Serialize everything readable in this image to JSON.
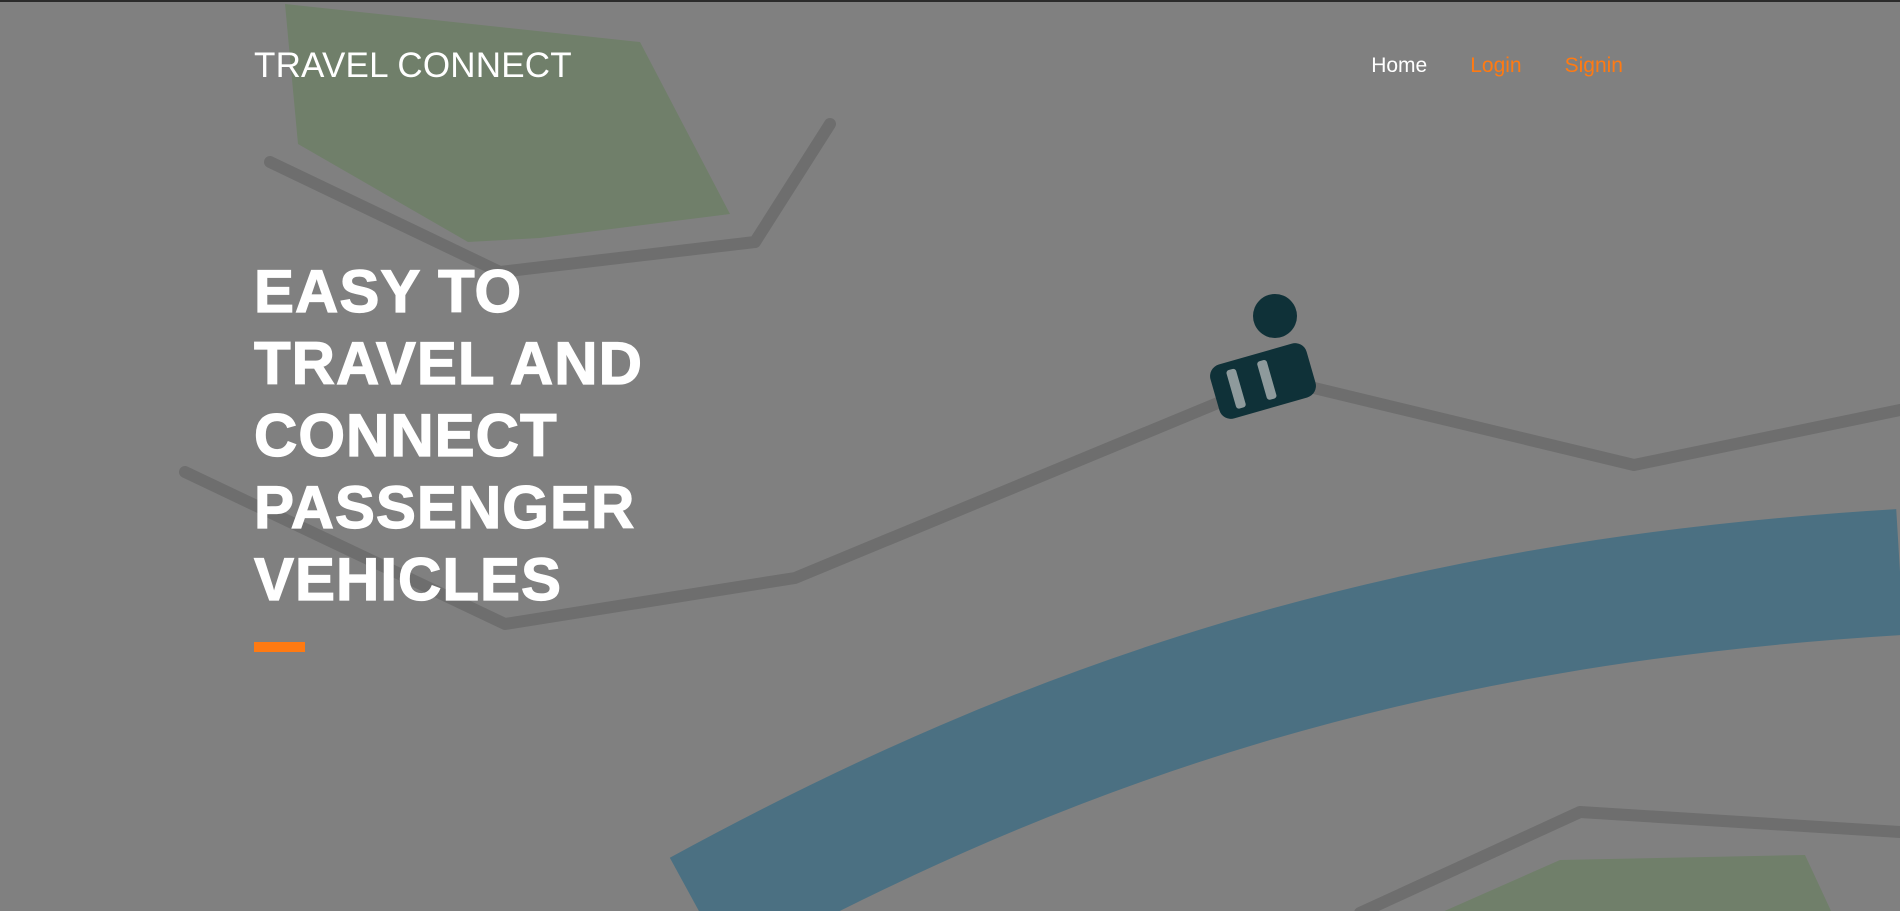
{
  "header": {
    "brand": "TRAVEL CONNECT"
  },
  "nav": {
    "items": [
      {
        "label": "Home",
        "active": true
      },
      {
        "label": "Login",
        "active": false
      },
      {
        "label": "Signin",
        "active": false
      }
    ]
  },
  "hero": {
    "lines": [
      "EASY TO",
      "TRAVEL AND",
      "CONNECT",
      "PASSENGER",
      "VEHICLES"
    ]
  },
  "colors": {
    "accent": "#ff7a12",
    "overlay": "#808080",
    "river": "#4b7082",
    "park": "#707f6a",
    "road": "#6e6e6e",
    "vehicle": "#0f3138"
  },
  "icons": {
    "map_marker": "car-location-icon"
  }
}
